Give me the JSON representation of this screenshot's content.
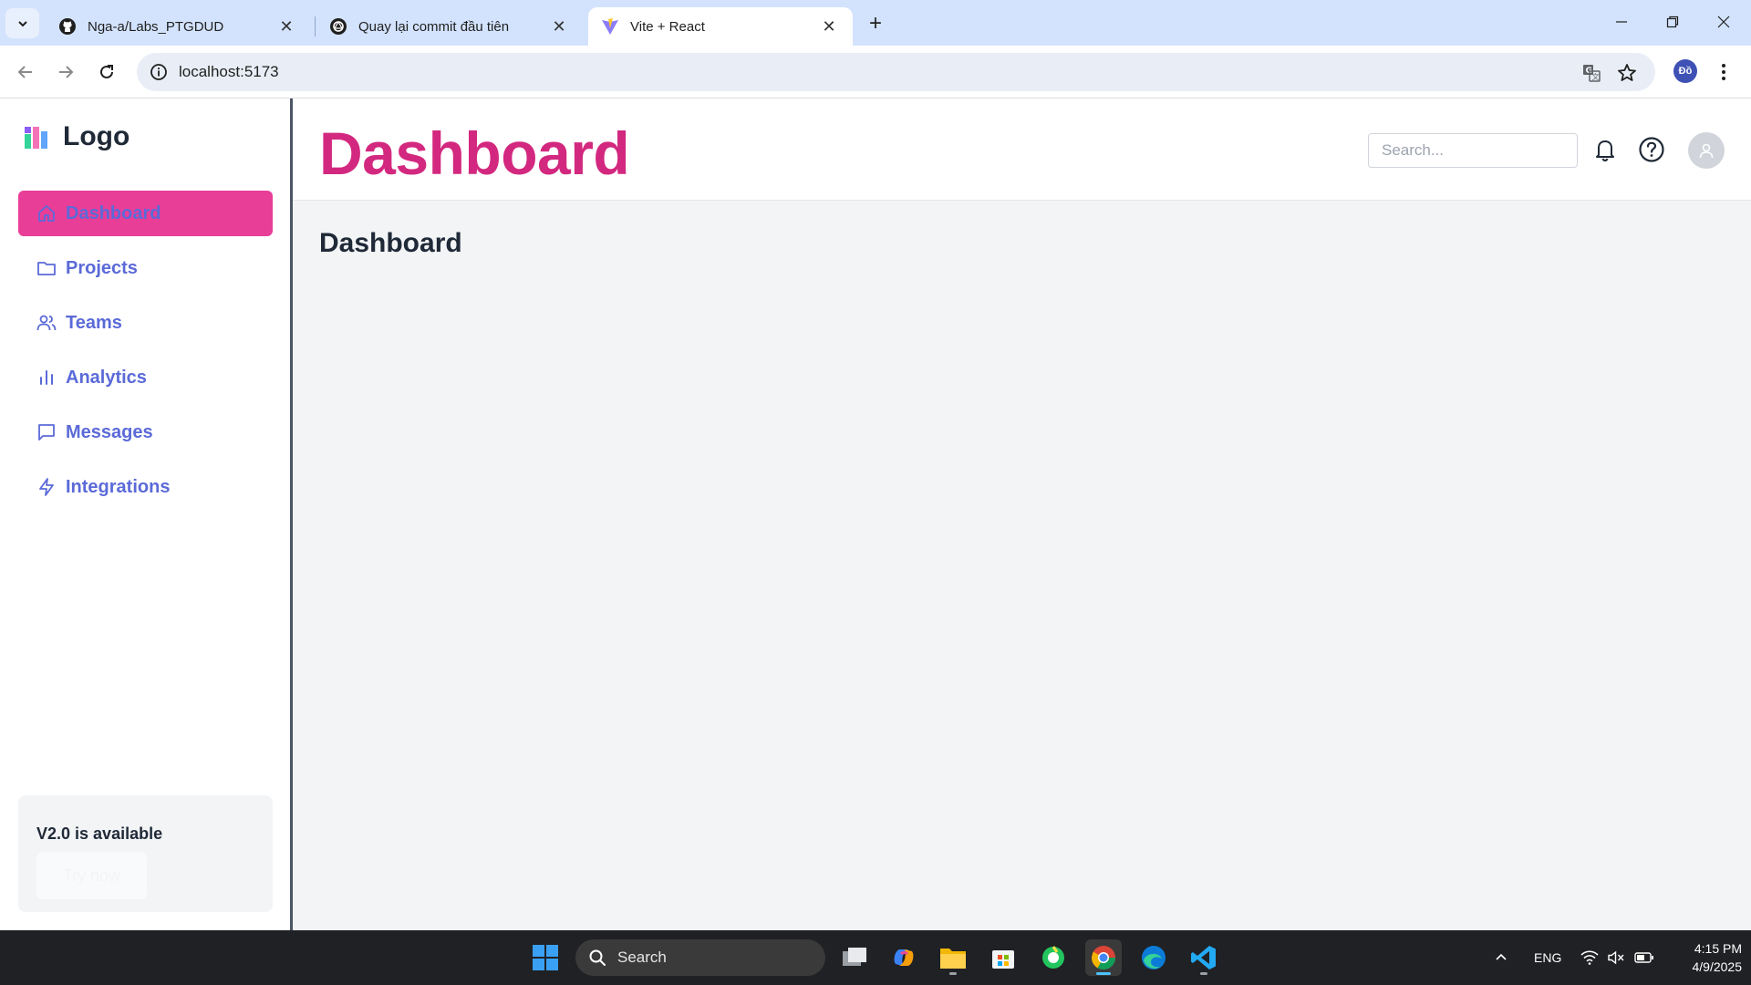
{
  "browser": {
    "tabs": [
      {
        "title": "Nga-a/Labs_PTGDUD",
        "icon": "github-icon",
        "active": false
      },
      {
        "title": "Quay lại commit đầu tiên",
        "icon": "openai-icon",
        "active": false
      },
      {
        "title": "Vite + React",
        "icon": "vite-icon",
        "active": true
      }
    ],
    "url": "localhost:5173",
    "profile_initials": "Đồ"
  },
  "sidebar": {
    "logo_text": "Logo",
    "items": [
      {
        "label": "Dashboard",
        "icon": "home-icon",
        "active": true
      },
      {
        "label": "Projects",
        "icon": "folder-icon",
        "active": false
      },
      {
        "label": "Teams",
        "icon": "users-icon",
        "active": false
      },
      {
        "label": "Analytics",
        "icon": "bar-chart-icon",
        "active": false
      },
      {
        "label": "Messages",
        "icon": "message-icon",
        "active": false
      },
      {
        "label": "Integrations",
        "icon": "bolt-icon",
        "active": false
      }
    ],
    "promo": {
      "title": "V2.0 is available",
      "button": "Try now"
    }
  },
  "header": {
    "title": "Dashboard",
    "search_placeholder": "Search..."
  },
  "main": {
    "section_title": "Dashboard"
  },
  "taskbar": {
    "search_label": "Search",
    "language": "ENG",
    "time": "4:15 PM",
    "date": "4/9/2025"
  },
  "colors": {
    "accent_pink": "#e83e98",
    "title_pink": "#d3287f",
    "nav_blue": "#5b6ad8"
  }
}
